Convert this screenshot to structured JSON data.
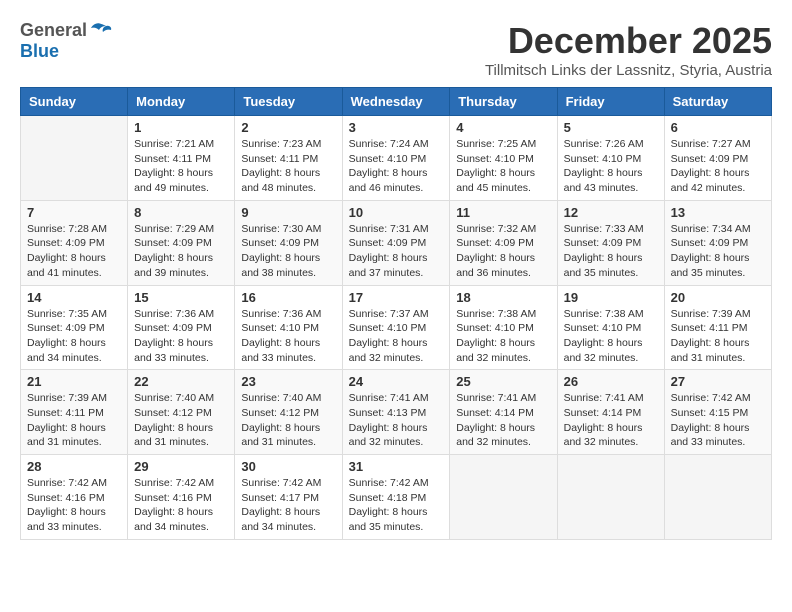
{
  "header": {
    "logo_general": "General",
    "logo_blue": "Blue",
    "month_year": "December 2025",
    "location": "Tillmitsch Links der Lassnitz, Styria, Austria"
  },
  "days_of_week": [
    "Sunday",
    "Monday",
    "Tuesday",
    "Wednesday",
    "Thursday",
    "Friday",
    "Saturday"
  ],
  "weeks": [
    [
      {
        "day": "",
        "info": ""
      },
      {
        "day": "1",
        "info": "Sunrise: 7:21 AM\nSunset: 4:11 PM\nDaylight: 8 hours\nand 49 minutes."
      },
      {
        "day": "2",
        "info": "Sunrise: 7:23 AM\nSunset: 4:11 PM\nDaylight: 8 hours\nand 48 minutes."
      },
      {
        "day": "3",
        "info": "Sunrise: 7:24 AM\nSunset: 4:10 PM\nDaylight: 8 hours\nand 46 minutes."
      },
      {
        "day": "4",
        "info": "Sunrise: 7:25 AM\nSunset: 4:10 PM\nDaylight: 8 hours\nand 45 minutes."
      },
      {
        "day": "5",
        "info": "Sunrise: 7:26 AM\nSunset: 4:10 PM\nDaylight: 8 hours\nand 43 minutes."
      },
      {
        "day": "6",
        "info": "Sunrise: 7:27 AM\nSunset: 4:09 PM\nDaylight: 8 hours\nand 42 minutes."
      }
    ],
    [
      {
        "day": "7",
        "info": "Sunrise: 7:28 AM\nSunset: 4:09 PM\nDaylight: 8 hours\nand 41 minutes."
      },
      {
        "day": "8",
        "info": "Sunrise: 7:29 AM\nSunset: 4:09 PM\nDaylight: 8 hours\nand 39 minutes."
      },
      {
        "day": "9",
        "info": "Sunrise: 7:30 AM\nSunset: 4:09 PM\nDaylight: 8 hours\nand 38 minutes."
      },
      {
        "day": "10",
        "info": "Sunrise: 7:31 AM\nSunset: 4:09 PM\nDaylight: 8 hours\nand 37 minutes."
      },
      {
        "day": "11",
        "info": "Sunrise: 7:32 AM\nSunset: 4:09 PM\nDaylight: 8 hours\nand 36 minutes."
      },
      {
        "day": "12",
        "info": "Sunrise: 7:33 AM\nSunset: 4:09 PM\nDaylight: 8 hours\nand 35 minutes."
      },
      {
        "day": "13",
        "info": "Sunrise: 7:34 AM\nSunset: 4:09 PM\nDaylight: 8 hours\nand 35 minutes."
      }
    ],
    [
      {
        "day": "14",
        "info": "Sunrise: 7:35 AM\nSunset: 4:09 PM\nDaylight: 8 hours\nand 34 minutes."
      },
      {
        "day": "15",
        "info": "Sunrise: 7:36 AM\nSunset: 4:09 PM\nDaylight: 8 hours\nand 33 minutes."
      },
      {
        "day": "16",
        "info": "Sunrise: 7:36 AM\nSunset: 4:10 PM\nDaylight: 8 hours\nand 33 minutes."
      },
      {
        "day": "17",
        "info": "Sunrise: 7:37 AM\nSunset: 4:10 PM\nDaylight: 8 hours\nand 32 minutes."
      },
      {
        "day": "18",
        "info": "Sunrise: 7:38 AM\nSunset: 4:10 PM\nDaylight: 8 hours\nand 32 minutes."
      },
      {
        "day": "19",
        "info": "Sunrise: 7:38 AM\nSunset: 4:10 PM\nDaylight: 8 hours\nand 32 minutes."
      },
      {
        "day": "20",
        "info": "Sunrise: 7:39 AM\nSunset: 4:11 PM\nDaylight: 8 hours\nand 31 minutes."
      }
    ],
    [
      {
        "day": "21",
        "info": "Sunrise: 7:39 AM\nSunset: 4:11 PM\nDaylight: 8 hours\nand 31 minutes."
      },
      {
        "day": "22",
        "info": "Sunrise: 7:40 AM\nSunset: 4:12 PM\nDaylight: 8 hours\nand 31 minutes."
      },
      {
        "day": "23",
        "info": "Sunrise: 7:40 AM\nSunset: 4:12 PM\nDaylight: 8 hours\nand 31 minutes."
      },
      {
        "day": "24",
        "info": "Sunrise: 7:41 AM\nSunset: 4:13 PM\nDaylight: 8 hours\nand 32 minutes."
      },
      {
        "day": "25",
        "info": "Sunrise: 7:41 AM\nSunset: 4:14 PM\nDaylight: 8 hours\nand 32 minutes."
      },
      {
        "day": "26",
        "info": "Sunrise: 7:41 AM\nSunset: 4:14 PM\nDaylight: 8 hours\nand 32 minutes."
      },
      {
        "day": "27",
        "info": "Sunrise: 7:42 AM\nSunset: 4:15 PM\nDaylight: 8 hours\nand 33 minutes."
      }
    ],
    [
      {
        "day": "28",
        "info": "Sunrise: 7:42 AM\nSunset: 4:16 PM\nDaylight: 8 hours\nand 33 minutes."
      },
      {
        "day": "29",
        "info": "Sunrise: 7:42 AM\nSunset: 4:16 PM\nDaylight: 8 hours\nand 34 minutes."
      },
      {
        "day": "30",
        "info": "Sunrise: 7:42 AM\nSunset: 4:17 PM\nDaylight: 8 hours\nand 34 minutes."
      },
      {
        "day": "31",
        "info": "Sunrise: 7:42 AM\nSunset: 4:18 PM\nDaylight: 8 hours\nand 35 minutes."
      },
      {
        "day": "",
        "info": ""
      },
      {
        "day": "",
        "info": ""
      },
      {
        "day": "",
        "info": ""
      }
    ]
  ]
}
